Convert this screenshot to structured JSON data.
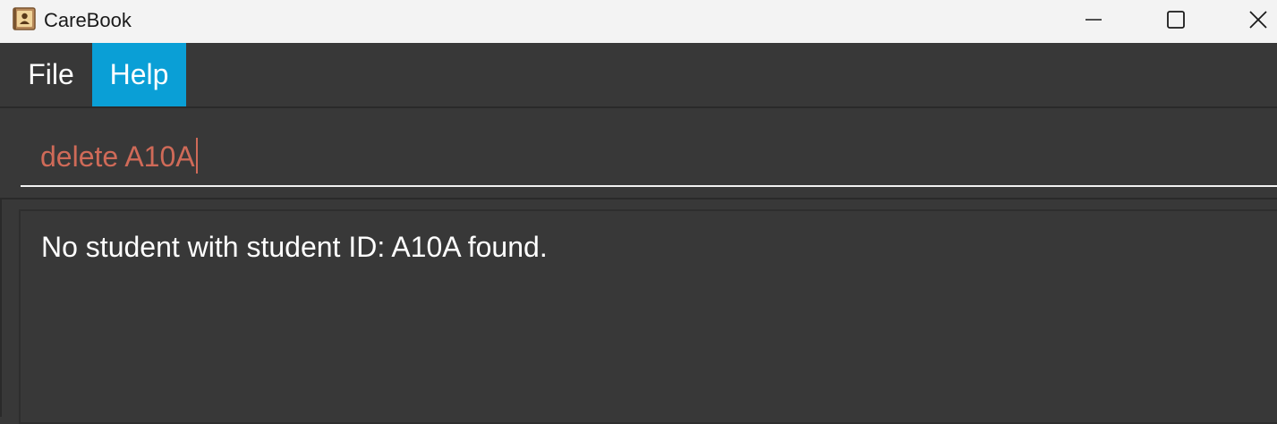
{
  "window": {
    "title": "CareBook",
    "app_icon": "contact-book-icon",
    "controls": {
      "minimize": "minimize-icon",
      "maximize": "maximize-icon",
      "close": "close-icon"
    }
  },
  "menubar": {
    "items": [
      {
        "label": "File"
      },
      {
        "label": "Help",
        "highlighted": true
      }
    ]
  },
  "command": {
    "value": "delete A10A",
    "text_color": "#cf6a58"
  },
  "result": {
    "message": "No student with student ID: A10A found."
  },
  "colors": {
    "titlebar_bg": "#f3f3f3",
    "app_bg": "#383838",
    "menu_highlight": "#0a9fd6"
  }
}
